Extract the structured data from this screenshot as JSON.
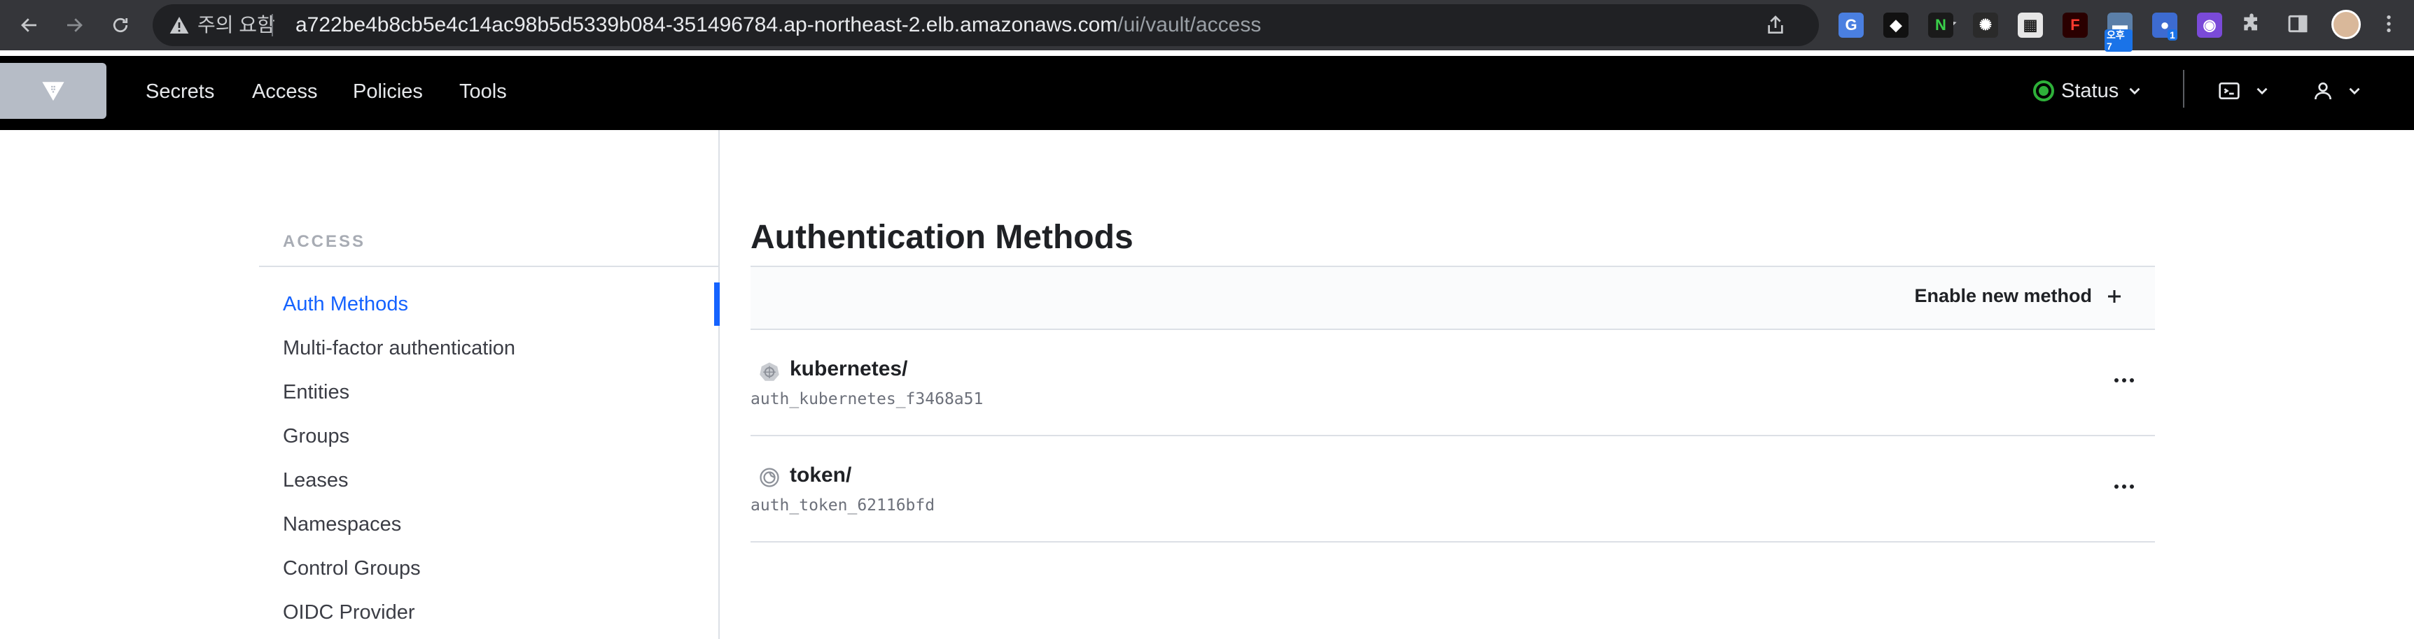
{
  "browser": {
    "security_label": "주의 요함",
    "url_host": "a722be4b8cb5e4c14ac98b5d5339b084-351496784.ap-northeast-2.elb.amazonaws.com",
    "url_path": "/ui/vault/access",
    "extensions": [
      {
        "name": "google-translate-icon",
        "glyph": "G",
        "color": "#4a7fe0"
      },
      {
        "name": "notion-like-icon",
        "glyph": "◆",
        "color": "#111111"
      },
      {
        "name": "n-extension-icon",
        "glyph": "N",
        "color": "#1a1a1a"
      },
      {
        "name": "openai-icon",
        "glyph": "✺",
        "color": "#2a2a2a"
      },
      {
        "name": "qr-code-icon",
        "glyph": "▦",
        "color": "#e6e6e6"
      },
      {
        "name": "f-extension-icon",
        "glyph": "F",
        "color": "#2a0000"
      },
      {
        "name": "calendar-icon",
        "glyph": "▬",
        "color": "#5b7fa8",
        "badge": "오후 7"
      },
      {
        "name": "globe-extension-icon",
        "glyph": "●",
        "color": "#3d6bd1",
        "badge": "1"
      },
      {
        "name": "color-wheel-icon",
        "glyph": "◉",
        "color": "#7a4ad8"
      }
    ]
  },
  "nav": {
    "links": [
      "Secrets",
      "Access",
      "Policies",
      "Tools"
    ],
    "status_label": "Status",
    "status_color": "#2eb039"
  },
  "sidebar": {
    "heading": "ACCESS",
    "items": [
      {
        "label": "Auth Methods",
        "active": true
      },
      {
        "label": "Multi-factor authentication",
        "active": false
      },
      {
        "label": "Entities",
        "active": false
      },
      {
        "label": "Groups",
        "active": false
      },
      {
        "label": "Leases",
        "active": false
      },
      {
        "label": "Namespaces",
        "active": false
      },
      {
        "label": "Control Groups",
        "active": false
      },
      {
        "label": "OIDC Provider",
        "active": false
      }
    ]
  },
  "main": {
    "title": "Authentication Methods",
    "enable_button_label": "Enable new method",
    "methods": [
      {
        "path": "kubernetes/",
        "accessor": "auth_kubernetes_f3468a51",
        "icon": "kubernetes-icon"
      },
      {
        "path": "token/",
        "accessor": "auth_token_62116bfd",
        "icon": "token-icon"
      }
    ]
  },
  "colors": {
    "accent": "#1563ff",
    "nav_bg": "#000000"
  }
}
